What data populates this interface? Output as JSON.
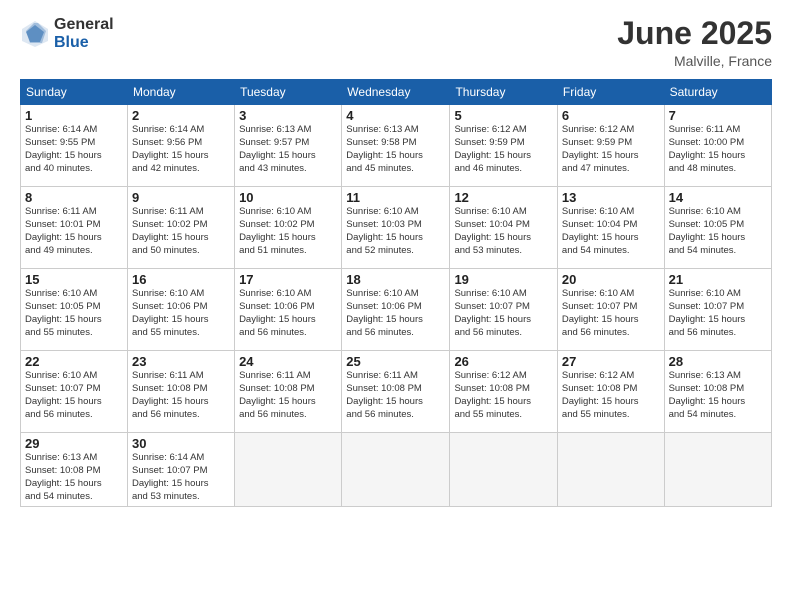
{
  "header": {
    "logo_general": "General",
    "logo_blue": "Blue",
    "month": "June 2025",
    "location": "Malville, France"
  },
  "weekdays": [
    "Sunday",
    "Monday",
    "Tuesday",
    "Wednesday",
    "Thursday",
    "Friday",
    "Saturday"
  ],
  "weeks": [
    [
      {
        "day": "1",
        "info": "Sunrise: 6:14 AM\nSunset: 9:55 PM\nDaylight: 15 hours\nand 40 minutes."
      },
      {
        "day": "2",
        "info": "Sunrise: 6:14 AM\nSunset: 9:56 PM\nDaylight: 15 hours\nand 42 minutes."
      },
      {
        "day": "3",
        "info": "Sunrise: 6:13 AM\nSunset: 9:57 PM\nDaylight: 15 hours\nand 43 minutes."
      },
      {
        "day": "4",
        "info": "Sunrise: 6:13 AM\nSunset: 9:58 PM\nDaylight: 15 hours\nand 45 minutes."
      },
      {
        "day": "5",
        "info": "Sunrise: 6:12 AM\nSunset: 9:59 PM\nDaylight: 15 hours\nand 46 minutes."
      },
      {
        "day": "6",
        "info": "Sunrise: 6:12 AM\nSunset: 9:59 PM\nDaylight: 15 hours\nand 47 minutes."
      },
      {
        "day": "7",
        "info": "Sunrise: 6:11 AM\nSunset: 10:00 PM\nDaylight: 15 hours\nand 48 minutes."
      }
    ],
    [
      {
        "day": "8",
        "info": "Sunrise: 6:11 AM\nSunset: 10:01 PM\nDaylight: 15 hours\nand 49 minutes."
      },
      {
        "day": "9",
        "info": "Sunrise: 6:11 AM\nSunset: 10:02 PM\nDaylight: 15 hours\nand 50 minutes."
      },
      {
        "day": "10",
        "info": "Sunrise: 6:10 AM\nSunset: 10:02 PM\nDaylight: 15 hours\nand 51 minutes."
      },
      {
        "day": "11",
        "info": "Sunrise: 6:10 AM\nSunset: 10:03 PM\nDaylight: 15 hours\nand 52 minutes."
      },
      {
        "day": "12",
        "info": "Sunrise: 6:10 AM\nSunset: 10:04 PM\nDaylight: 15 hours\nand 53 minutes."
      },
      {
        "day": "13",
        "info": "Sunrise: 6:10 AM\nSunset: 10:04 PM\nDaylight: 15 hours\nand 54 minutes."
      },
      {
        "day": "14",
        "info": "Sunrise: 6:10 AM\nSunset: 10:05 PM\nDaylight: 15 hours\nand 54 minutes."
      }
    ],
    [
      {
        "day": "15",
        "info": "Sunrise: 6:10 AM\nSunset: 10:05 PM\nDaylight: 15 hours\nand 55 minutes."
      },
      {
        "day": "16",
        "info": "Sunrise: 6:10 AM\nSunset: 10:06 PM\nDaylight: 15 hours\nand 55 minutes."
      },
      {
        "day": "17",
        "info": "Sunrise: 6:10 AM\nSunset: 10:06 PM\nDaylight: 15 hours\nand 56 minutes."
      },
      {
        "day": "18",
        "info": "Sunrise: 6:10 AM\nSunset: 10:06 PM\nDaylight: 15 hours\nand 56 minutes."
      },
      {
        "day": "19",
        "info": "Sunrise: 6:10 AM\nSunset: 10:07 PM\nDaylight: 15 hours\nand 56 minutes."
      },
      {
        "day": "20",
        "info": "Sunrise: 6:10 AM\nSunset: 10:07 PM\nDaylight: 15 hours\nand 56 minutes."
      },
      {
        "day": "21",
        "info": "Sunrise: 6:10 AM\nSunset: 10:07 PM\nDaylight: 15 hours\nand 56 minutes."
      }
    ],
    [
      {
        "day": "22",
        "info": "Sunrise: 6:10 AM\nSunset: 10:07 PM\nDaylight: 15 hours\nand 56 minutes."
      },
      {
        "day": "23",
        "info": "Sunrise: 6:11 AM\nSunset: 10:08 PM\nDaylight: 15 hours\nand 56 minutes."
      },
      {
        "day": "24",
        "info": "Sunrise: 6:11 AM\nSunset: 10:08 PM\nDaylight: 15 hours\nand 56 minutes."
      },
      {
        "day": "25",
        "info": "Sunrise: 6:11 AM\nSunset: 10:08 PM\nDaylight: 15 hours\nand 56 minutes."
      },
      {
        "day": "26",
        "info": "Sunrise: 6:12 AM\nSunset: 10:08 PM\nDaylight: 15 hours\nand 55 minutes."
      },
      {
        "day": "27",
        "info": "Sunrise: 6:12 AM\nSunset: 10:08 PM\nDaylight: 15 hours\nand 55 minutes."
      },
      {
        "day": "28",
        "info": "Sunrise: 6:13 AM\nSunset: 10:08 PM\nDaylight: 15 hours\nand 54 minutes."
      }
    ],
    [
      {
        "day": "29",
        "info": "Sunrise: 6:13 AM\nSunset: 10:08 PM\nDaylight: 15 hours\nand 54 minutes."
      },
      {
        "day": "30",
        "info": "Sunrise: 6:14 AM\nSunset: 10:07 PM\nDaylight: 15 hours\nand 53 minutes."
      },
      null,
      null,
      null,
      null,
      null
    ]
  ]
}
